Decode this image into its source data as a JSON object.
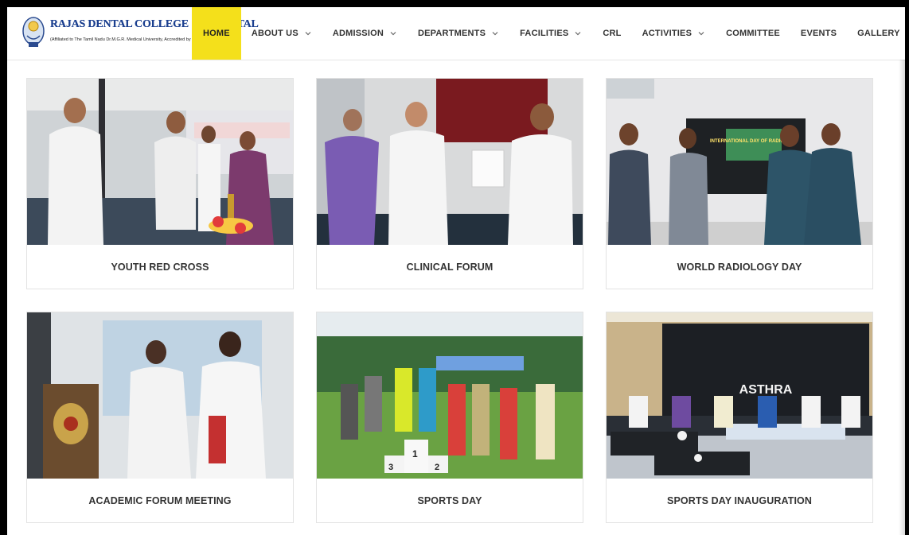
{
  "logo": {
    "title": "RAJAS DENTAL COLLEGE & HOSPITAL",
    "subtitle": "(Affiliated to The Tamil Nadu Dr.M.G.R. Medical University, Accredited by NAAC)"
  },
  "nav": {
    "items": [
      {
        "label": "HOME",
        "active": true,
        "dropdown": false
      },
      {
        "label": "ABOUT US",
        "active": false,
        "dropdown": true
      },
      {
        "label": "ADMISSION",
        "active": false,
        "dropdown": true
      },
      {
        "label": "DEPARTMENTS",
        "active": false,
        "dropdown": true
      },
      {
        "label": "FACILITIES",
        "active": false,
        "dropdown": true
      },
      {
        "label": "CRL",
        "active": false,
        "dropdown": false
      },
      {
        "label": "ACTIVITIES",
        "active": false,
        "dropdown": true
      },
      {
        "label": "COMMITTEE",
        "active": false,
        "dropdown": false
      },
      {
        "label": "EVENTS",
        "active": false,
        "dropdown": false
      },
      {
        "label": "GALLERY",
        "active": false,
        "dropdown": false
      }
    ]
  },
  "gallery": {
    "cards": [
      {
        "caption": "YOUTH RED CROSS"
      },
      {
        "caption": "CLINICAL FORUM"
      },
      {
        "caption": "WORLD RADIOLOGY DAY"
      },
      {
        "caption": "ACADEMIC FORUM MEETING"
      },
      {
        "caption": "SPORTS DAY"
      },
      {
        "caption": "SPORTS DAY INAUGURATION"
      }
    ],
    "screen_text": {
      "radiology": "INTERNATIONAL DAY OF RADIOLOGY",
      "inauguration": "ASTHRA",
      "podium_left": "3",
      "podium_mid": "1",
      "podium_right": "2"
    }
  },
  "colors": {
    "accent": "#f4e01b",
    "logo_blue": "#1b3f8f",
    "caption_text": "#333333"
  }
}
